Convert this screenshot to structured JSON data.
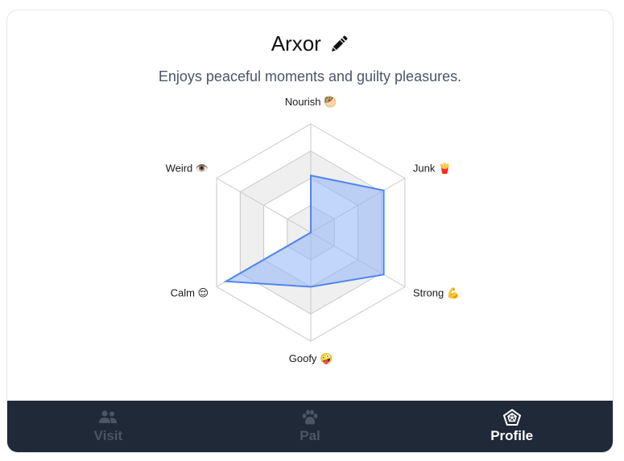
{
  "profile": {
    "name": "Arxor",
    "description": "Enjoys peaceful moments and guilty pleasures."
  },
  "chart_data": {
    "type": "radar",
    "axes": [
      "Nourish",
      "Junk",
      "Strong",
      "Goofy",
      "Calm",
      "Weird"
    ],
    "axis_emojis": [
      "🥙",
      "🍟",
      "💪",
      "🤪",
      "😌",
      "👁️"
    ],
    "scale_max": 4,
    "rings": 4,
    "values": [
      2.1,
      3.1,
      3.1,
      2.0,
      3.6,
      0
    ],
    "fill_color": "#8fb3f5",
    "stroke_color": "#4f86ec"
  },
  "nav": {
    "items": [
      {
        "label": "Visit",
        "icon": "people-icon",
        "active": false
      },
      {
        "label": "Pal",
        "icon": "paw-icon",
        "active": false
      },
      {
        "label": "Profile",
        "icon": "pentagon-radar-icon",
        "active": true
      }
    ]
  }
}
